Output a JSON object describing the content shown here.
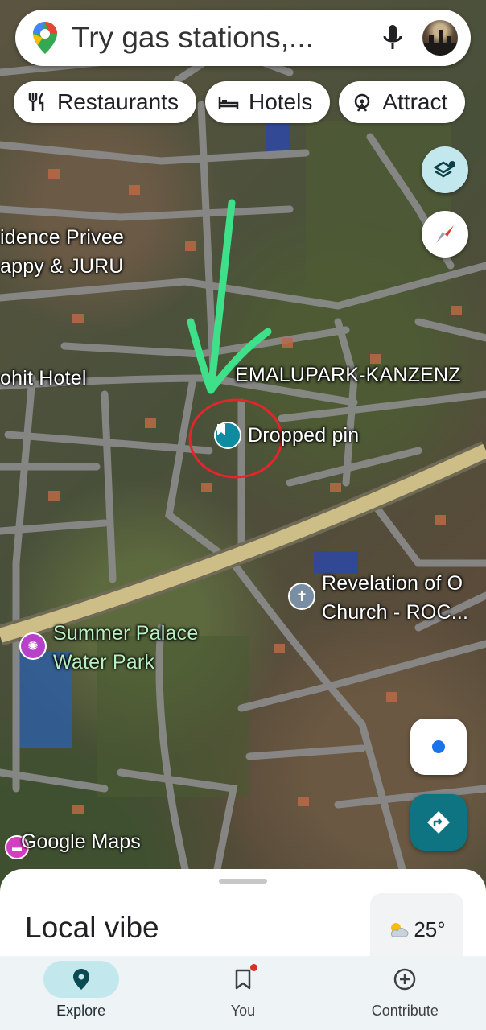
{
  "search": {
    "placeholder": "Try gas stations,..."
  },
  "chips": [
    {
      "label": "Restaurants",
      "icon": "fork-knife-icon"
    },
    {
      "label": "Hotels",
      "icon": "bed-icon"
    },
    {
      "label": "Attract",
      "icon": "attraction-icon"
    }
  ],
  "map": {
    "labels": {
      "residence": "idence Privee",
      "happy": "appy & JURU",
      "hotel": "ohit Hotel",
      "emalupark": "EMALUPARK-KANZENZ",
      "dropped_pin": "Dropped pin",
      "church_line1": "Revelation of O",
      "church_line2": "Church - ROC...",
      "water_line1": "Summer Palace",
      "water_line2": "Water Park"
    },
    "watermark": "Google Maps",
    "annotation_colors": {
      "arrow": "#3ee08a",
      "circle": "#e3262b"
    }
  },
  "sheet": {
    "title": "Local vibe",
    "weather": {
      "temp": "25°",
      "icon": "partly-sunny-icon"
    }
  },
  "nav": [
    {
      "label": "Explore",
      "icon": "location-pin-icon",
      "active": true
    },
    {
      "label": "You",
      "icon": "bookmark-icon",
      "badge": true
    },
    {
      "label": "Contribute",
      "icon": "plus-circle-icon"
    }
  ],
  "colors": {
    "accent": "#0e7482",
    "active_pill": "#c2e8ee",
    "blue_dot": "#1a73e8"
  }
}
